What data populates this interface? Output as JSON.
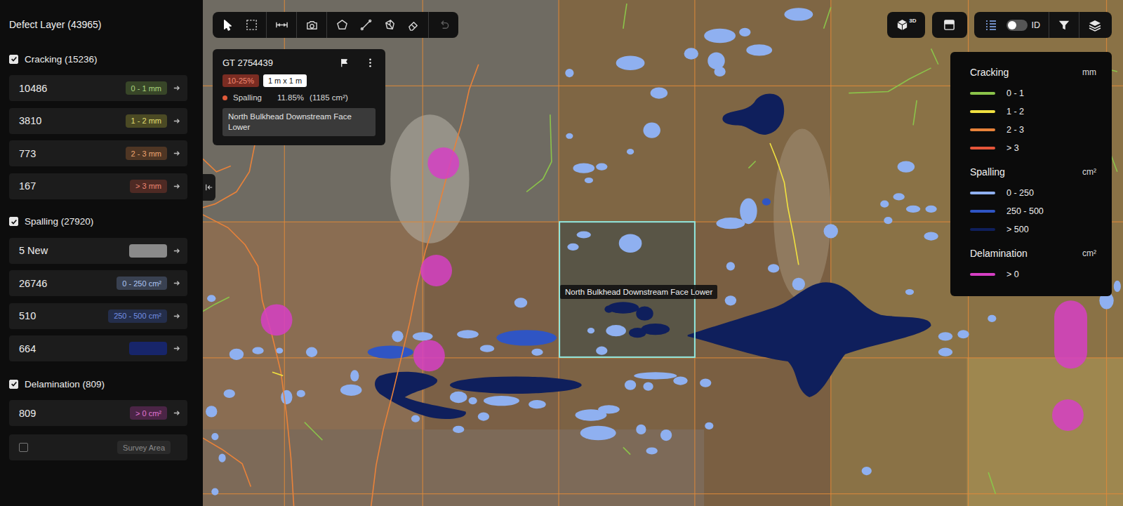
{
  "sidebar": {
    "title": "Defect Layer (43965)",
    "groups": [
      {
        "label": "Cracking (15236)",
        "checked": true,
        "items": [
          {
            "count": "10486",
            "badge": "0 - 1 mm",
            "color": "#8bc34a"
          },
          {
            "count": "3810",
            "badge": "1 - 2 mm",
            "color": "#d8d33a"
          },
          {
            "count": "773",
            "badge": "2 - 3 mm",
            "color": "#e8823a"
          },
          {
            "count": "167",
            "badge": "> 3 mm",
            "color": "#e5553a"
          }
        ]
      },
      {
        "label": "Spalling (27920)",
        "checked": true,
        "items": [
          {
            "count": "5 New",
            "color": "#8a8a8a"
          },
          {
            "count": "26746",
            "badge": "0 - 250 cm²",
            "color": "#8fb0f0"
          },
          {
            "count": "510",
            "badge": "250 - 500 cm²",
            "color": "#3d64d8"
          },
          {
            "count": "664",
            "color": "#17256a"
          }
        ]
      },
      {
        "label": "Delamination (809)",
        "checked": true,
        "items": [
          {
            "count": "809",
            "badge": "> 0 cm²",
            "color": "#d63fc4"
          }
        ]
      }
    ],
    "survey_area": {
      "label": "Survey Area",
      "checked": false
    }
  },
  "toolbar": {
    "tools": [
      {
        "selected": true,
        "disabled": false
      },
      {
        "selected": false,
        "disabled": false
      },
      {
        "selected": false,
        "disabled": false
      },
      {
        "selected": false,
        "disabled": false
      },
      {
        "selected": false,
        "disabled": false
      },
      {
        "selected": false,
        "disabled": false
      },
      {
        "selected": false,
        "disabled": false
      },
      {
        "selected": false,
        "disabled": false
      },
      {
        "selected": false,
        "disabled": true
      }
    ]
  },
  "view_controls": {
    "mode_3d": "3D",
    "id_toggle": {
      "label": "ID",
      "on": false
    }
  },
  "info_card": {
    "title": "GT 2754439",
    "tags": [
      {
        "label": "10-25%",
        "kind": "severity"
      },
      {
        "label": "1 m x 1 m",
        "kind": "size"
      }
    ],
    "defect": {
      "type": "Spalling",
      "percent": "11.85%",
      "area": "(1185 cm²)",
      "color": "#e05a3a"
    },
    "location": "North Bulkhead Downstream Face Lower"
  },
  "tooltip": "North Bulkhead Downstream Face Lower",
  "legend": {
    "sections": [
      {
        "title": "Cracking",
        "unit": "mm",
        "items": [
          {
            "label": "0 - 1",
            "color": "#8bc34a"
          },
          {
            "label": "1 - 2",
            "color": "#f0e040"
          },
          {
            "label": "2 - 3",
            "color": "#e8823a"
          },
          {
            "label": "> 3",
            "color": "#e5553a"
          }
        ]
      },
      {
        "title": "Spalling",
        "unit": "cm²",
        "items": [
          {
            "label": "0 - 250",
            "color": "#8fb0f0"
          },
          {
            "label": "250 - 500",
            "color": "#2f55c4"
          },
          {
            "label": "> 500",
            "color": "#0f1f5c"
          }
        ]
      },
      {
        "title": "Delamination",
        "unit": "cm²",
        "items": [
          {
            "label": "> 0",
            "color": "#d63fc4"
          }
        ]
      }
    ]
  }
}
